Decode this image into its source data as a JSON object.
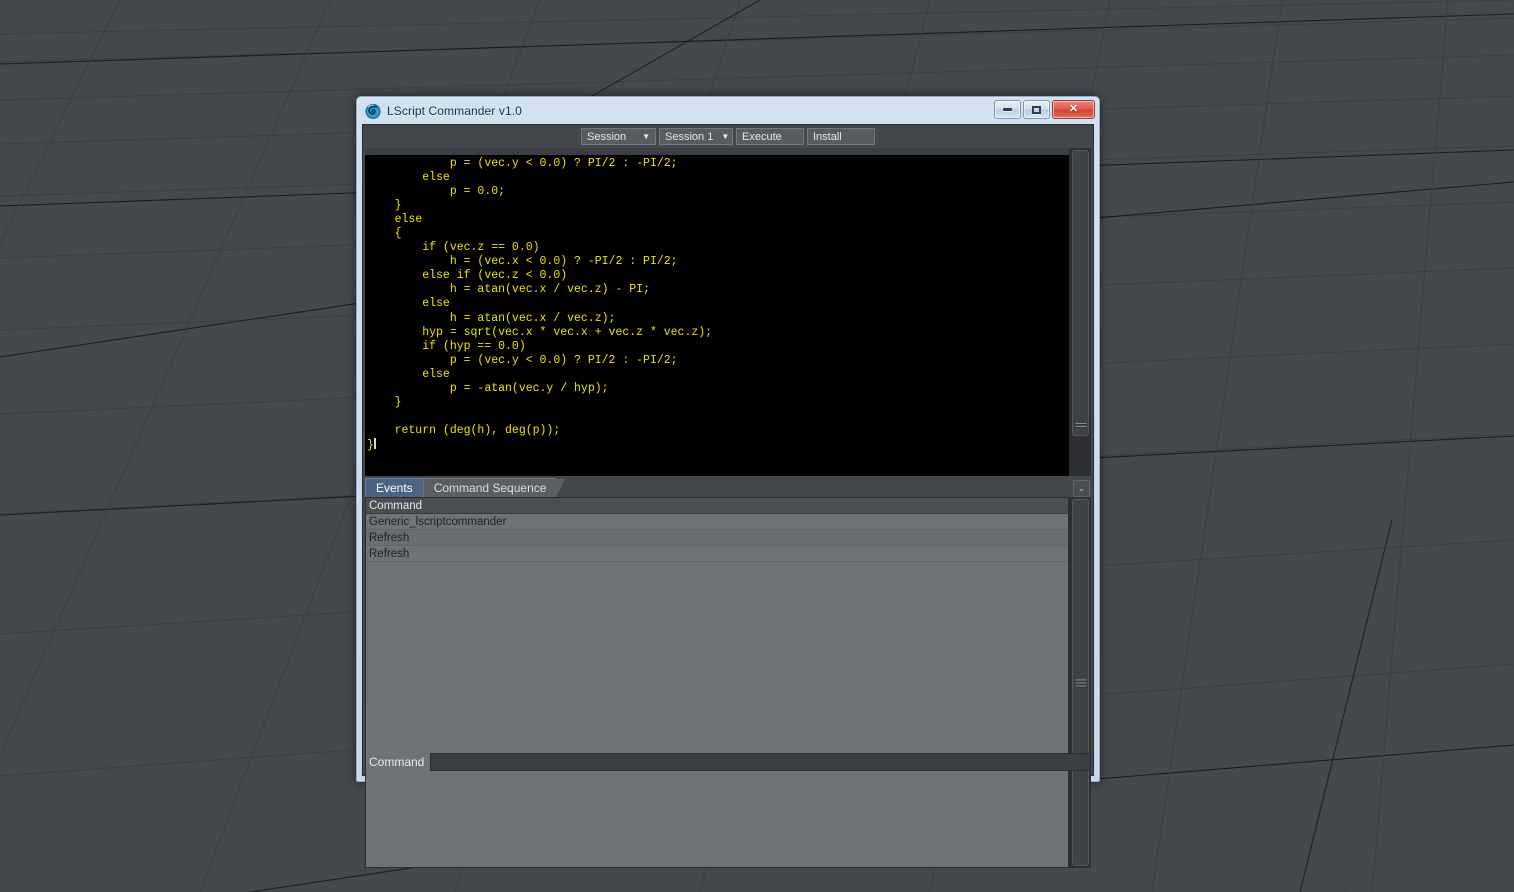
{
  "viewport": {
    "name": "lightwave-3d-perspective-grid",
    "bg_color": "#45494d",
    "grid_color": "#3a3e42"
  },
  "window": {
    "title": "LScript Commander v1.0",
    "icon": "lightwave-lscript-icon",
    "frame_color": "#cfdcec",
    "controls": {
      "minimize": "–",
      "maximize": "□",
      "close": "✕"
    }
  },
  "toolbar": {
    "session_dropdown": {
      "value": "Session",
      "arrow": "▼"
    },
    "session_number_dropdown": {
      "value": "Session 1",
      "arrow": "▼"
    },
    "execute_label": "Execute",
    "install_label": "Install"
  },
  "editor": {
    "bg_color": "#000000",
    "text_color": "#ebe400",
    "code": "            p = (vec.y < 0.0) ? PI/2 : -PI/2;\n        else\n            p = 0.0;\n    }\n    else\n    {\n        if (vec.z == 0.0)\n            h = (vec.x < 0.0) ? -PI/2 : PI/2;\n        else if (vec.z < 0.0)\n            h = atan(vec.x / vec.z) - PI;\n        else\n            h = atan(vec.x / vec.z);\n        hyp = sqrt(vec.x * vec.x + vec.z * vec.z);\n        if (hyp == 0.0)\n            p = (vec.y < 0.0) ? PI/2 : -PI/2;\n        else\n            p = -atan(vec.y / hyp);\n    }\n\n    return (deg(h), deg(p));\n}",
    "scroll_position": "bottom"
  },
  "tabs": [
    {
      "label": "Events",
      "active": true
    },
    {
      "label": "Command Sequence",
      "active": false
    }
  ],
  "tab_overflow_chevron": "⌄",
  "event_list": {
    "columns": [
      "Command"
    ],
    "rows": [
      [
        "Generic_lscriptcommander"
      ],
      [
        "Refresh"
      ],
      [
        "Refresh"
      ]
    ]
  },
  "command_bar": {
    "label": "Command",
    "value": "",
    "placeholder": ""
  }
}
